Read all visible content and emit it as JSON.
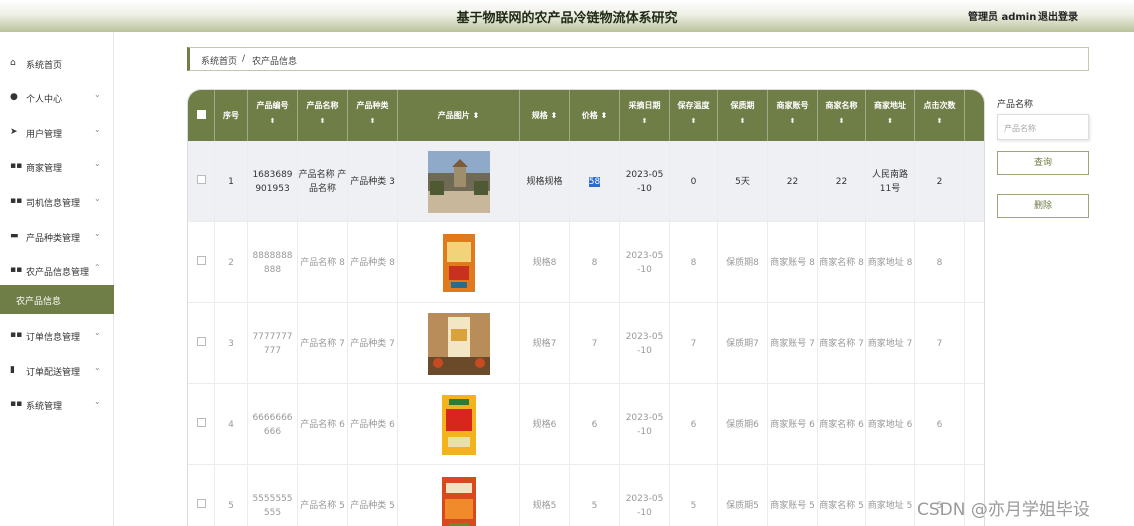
{
  "header": {
    "title": "基于物联网的农产品冷链物流体系研究",
    "user": "管理员 admin",
    "logout": "退出登录"
  },
  "sidebar": {
    "items": [
      {
        "label": "系统首页",
        "icon": "home-icon"
      },
      {
        "label": "个人中心",
        "icon": "person-icon"
      },
      {
        "label": "用户管理",
        "icon": "send-icon"
      },
      {
        "label": "商家管理",
        "icon": "grid-icon"
      },
      {
        "label": "司机信息管理",
        "icon": "grid-icon"
      },
      {
        "label": "产品种类管理",
        "icon": "screen-icon"
      },
      {
        "label": "农产品信息管理",
        "icon": "grid-icon"
      },
      {
        "label": "订单信息管理",
        "icon": "grid-icon"
      },
      {
        "label": "订单配送管理",
        "icon": "bar-icon"
      },
      {
        "label": "系统管理",
        "icon": "grid-icon"
      }
    ],
    "active_sub": "农产品信息"
  },
  "breadcrumb": {
    "home": "系统首页",
    "sep": "/",
    "current": "农产品信息"
  },
  "table": {
    "columns": [
      "序号",
      "产品编号",
      "产品名称",
      "产品种类",
      "产品图片",
      "规格",
      "价格",
      "采摘日期",
      "保存温度",
      "保质期",
      "商家账号",
      "商家名称",
      "商家地址",
      "点击次数"
    ],
    "sort_glyph": "⬍",
    "rows": [
      [
        "1",
        "1683689 901953",
        "产品名称 产品名称",
        "产品种类 3",
        "",
        "规格规格",
        "58",
        "2023-05 -10",
        "0",
        "5天",
        "22",
        "22",
        "人民南路 11号",
        "2"
      ],
      [
        "2",
        "8888888 888",
        "产品名称 8",
        "产品种类 8",
        "",
        "规格8",
        "8",
        "2023-05 -10",
        "8",
        "保质期8",
        "商家账号 8",
        "商家名称 8",
        "商家地址 8",
        "8"
      ],
      [
        "3",
        "7777777 777",
        "产品名称 7",
        "产品种类 7",
        "",
        "规格7",
        "7",
        "2023-05 -10",
        "7",
        "保质期7",
        "商家账号 7",
        "商家名称 7",
        "商家地址 7",
        "7"
      ],
      [
        "4",
        "6666666 666",
        "产品名称 6",
        "产品种类 6",
        "",
        "规格6",
        "6",
        "2023-05 -10",
        "6",
        "保质期6",
        "商家账号 6",
        "商家名称 6",
        "商家地址 6",
        "6"
      ],
      [
        "5",
        "5555555 555",
        "产品名称 5",
        "产品种类 5",
        "",
        "规格5",
        "5",
        "2023-05 -10",
        "5",
        "保质期5",
        "商家账号 5",
        "商家名称 5",
        "商家地址 5",
        "5"
      ]
    ]
  },
  "search": {
    "label": "产品名称",
    "placeholder": "产品名称",
    "query_button": "查询",
    "delete_button": "删除"
  },
  "watermark": "CSDN @亦月学姐毕设",
  "colors": {
    "accent": "#6f7d46",
    "selection": "#2d6ad2"
  }
}
